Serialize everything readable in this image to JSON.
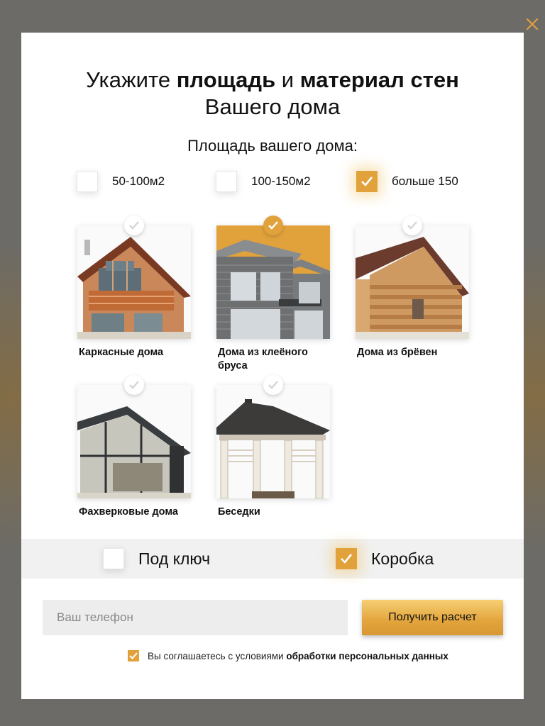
{
  "colors": {
    "accent": "#e1a23c",
    "overlay": "#6b6a67",
    "close": "#e0a040"
  },
  "icons": {
    "close": "close-icon",
    "check": "check-icon"
  },
  "modal": {
    "title": {
      "part1": "Укажите ",
      "bold1": "площадь",
      "part2": " и ",
      "bold2": "материал стен",
      "line2": "Вашего дома"
    },
    "area_label": "Площадь вашего дома:",
    "area_options": [
      {
        "label": "50-100м2",
        "checked": false
      },
      {
        "label": "100-150м2",
        "checked": false
      },
      {
        "label": "больше 150",
        "checked": true
      }
    ],
    "materials": [
      {
        "label": "Каркасные дома",
        "selected": false
      },
      {
        "label": "Дома из клеёного бруса",
        "selected": true
      },
      {
        "label": "Дома из брёвен",
        "selected": false
      },
      {
        "label": "Фахверковые дома",
        "selected": false
      },
      {
        "label": "Беседки",
        "selected": false
      }
    ],
    "finish_options": [
      {
        "label": "Под ключ",
        "checked": false
      },
      {
        "label": "Коробка",
        "checked": true
      }
    ],
    "phone": {
      "placeholder": "Ваш телефон",
      "value": ""
    },
    "submit_label": "Получить расчет",
    "consent": {
      "checked": true,
      "text": "Вы соглашаетесь с условиями ",
      "link": "обработки персональных данных"
    }
  }
}
